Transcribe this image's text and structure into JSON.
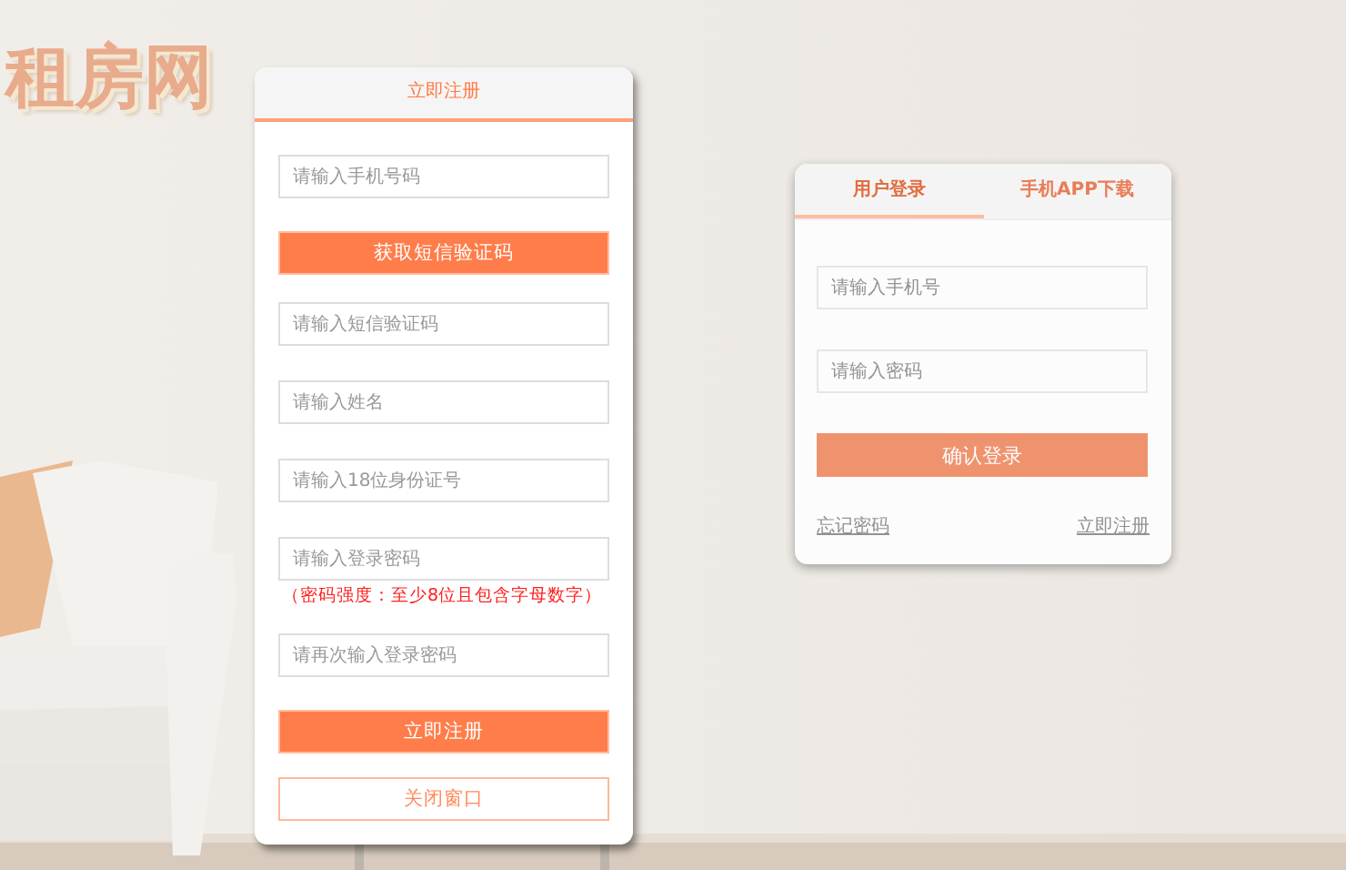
{
  "page_title": "租房网",
  "login": {
    "tabs": [
      {
        "label": "用户登录",
        "selected": true
      },
      {
        "label": "手机APP下载",
        "selected": false
      }
    ],
    "fields": [
      {
        "placeholder": "请输入手机号"
      },
      {
        "placeholder": "请输入密码"
      }
    ],
    "submit": "确认登录",
    "links": [
      "忘记密码",
      "立即注册"
    ]
  },
  "register": {
    "title": "立即注册",
    "items": [
      {
        "kind": "field",
        "placeholder": "请输入手机号码"
      },
      {
        "kind": "button",
        "label": "获取短信验证码"
      },
      {
        "kind": "field",
        "placeholder": "请输入短信验证码"
      },
      {
        "kind": "field",
        "placeholder": "请输入姓名"
      },
      {
        "kind": "field",
        "placeholder": "请输入18位身份证号"
      },
      {
        "kind": "field",
        "placeholder": "请输入登录密码"
      },
      {
        "kind": "hint",
        "text": "（密码强度：至少8位且包含字母数字）"
      },
      {
        "kind": "field",
        "placeholder": "请再次输入登录密码"
      },
      {
        "kind": "button",
        "label": "立即注册"
      },
      {
        "kind": "outline",
        "label": "关闭窗口"
      }
    ]
  }
}
